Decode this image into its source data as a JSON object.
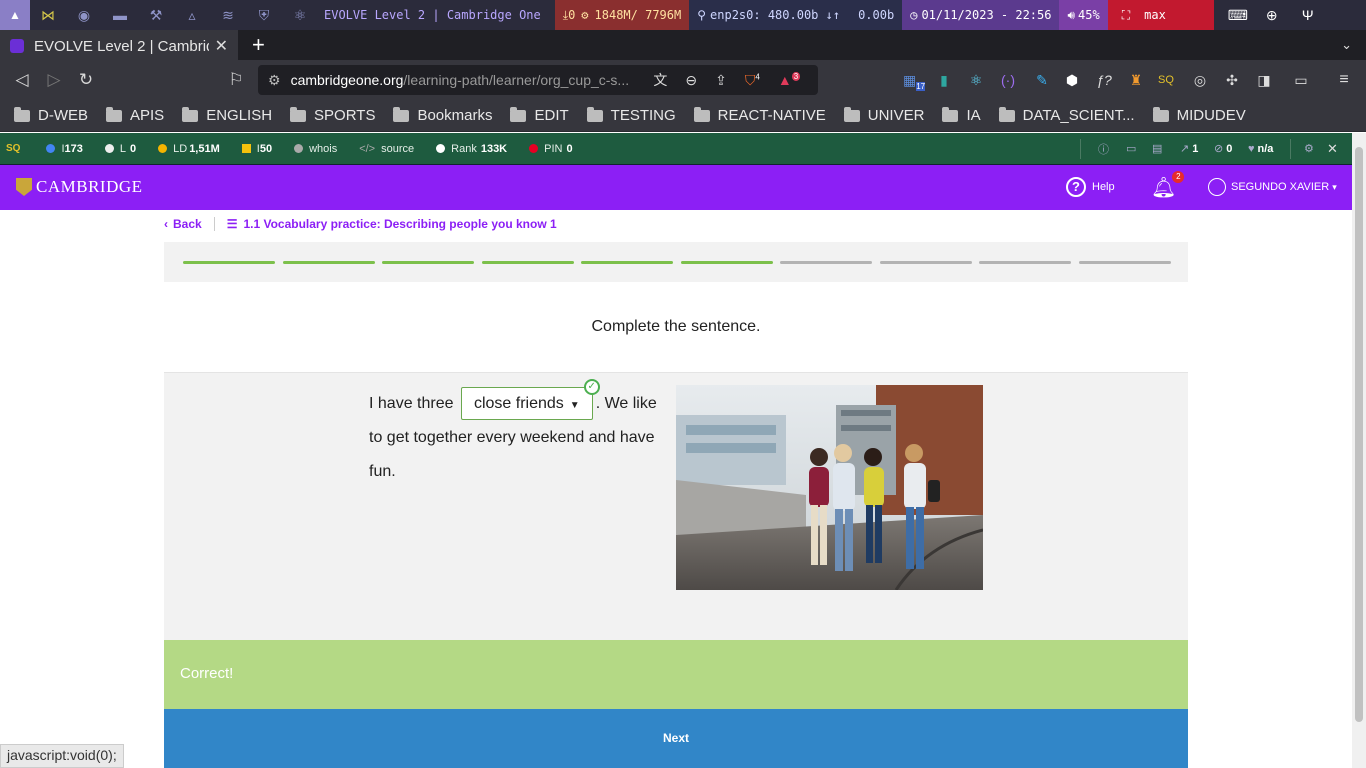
{
  "sysbar": {
    "title": "EVOLVE Level 2 | Cambridge One",
    "downloads": "0",
    "memory": "1848M/ 7796M",
    "network": "enp2s0: 480.00b ↓↑",
    "network2": "0.00b",
    "datetime": "01/11/2023 - 22:56",
    "volume": "45%",
    "layout": "max"
  },
  "tab": {
    "title": "EVOLVE Level 2 | Cambridge One"
  },
  "url": {
    "host": "cambridgeone.org",
    "path": "/learning-path/learner/org_cup_c-s..."
  },
  "extensions": {
    "brave_badge": "4",
    "alert_badge": "3",
    "cal_badge": "17"
  },
  "bookmarks": [
    "D-WEB",
    "APIS",
    "ENGLISH",
    "SPORTS",
    "Bookmarks",
    "EDIT",
    "TESTING",
    "REACT-NATIVE",
    "UNIVER",
    "IA",
    "DATA_SCIENT...",
    "MIDUDEV"
  ],
  "seo": {
    "items": [
      {
        "label": "I",
        "value": "173"
      },
      {
        "label": "L",
        "value": "0"
      },
      {
        "label": "LD",
        "value": "1,51M"
      },
      {
        "label": "I",
        "value": "50"
      },
      {
        "label": "whois",
        "value": ""
      },
      {
        "label": "source",
        "value": ""
      },
      {
        "label": "Rank",
        "value": "133K"
      },
      {
        "label": "PIN",
        "value": "0"
      }
    ],
    "right": [
      {
        "value": "1"
      },
      {
        "value": "0"
      },
      {
        "value": "n/a"
      }
    ]
  },
  "header": {
    "logo": "CAMBRIDGE",
    "help": "Help",
    "notifications": "2",
    "user": "SEGUNDO XAVIER"
  },
  "breadcrumb": {
    "back": "Back",
    "lesson": "1.1 Vocabulary practice: Describing people you know 1"
  },
  "progress": {
    "total": 10,
    "completed": 6,
    "done_color": "#7cc04b",
    "todo_color": "#b3b3b3"
  },
  "exercise": {
    "instruction": "Complete the sentence.",
    "before": "I have three",
    "answer": "close friends",
    "after": ". We like to get together every weekend and have fun."
  },
  "feedback": {
    "text": "Correct!"
  },
  "next": {
    "label": "Next"
  },
  "statusbar": {
    "text": "javascript:void(0);"
  }
}
